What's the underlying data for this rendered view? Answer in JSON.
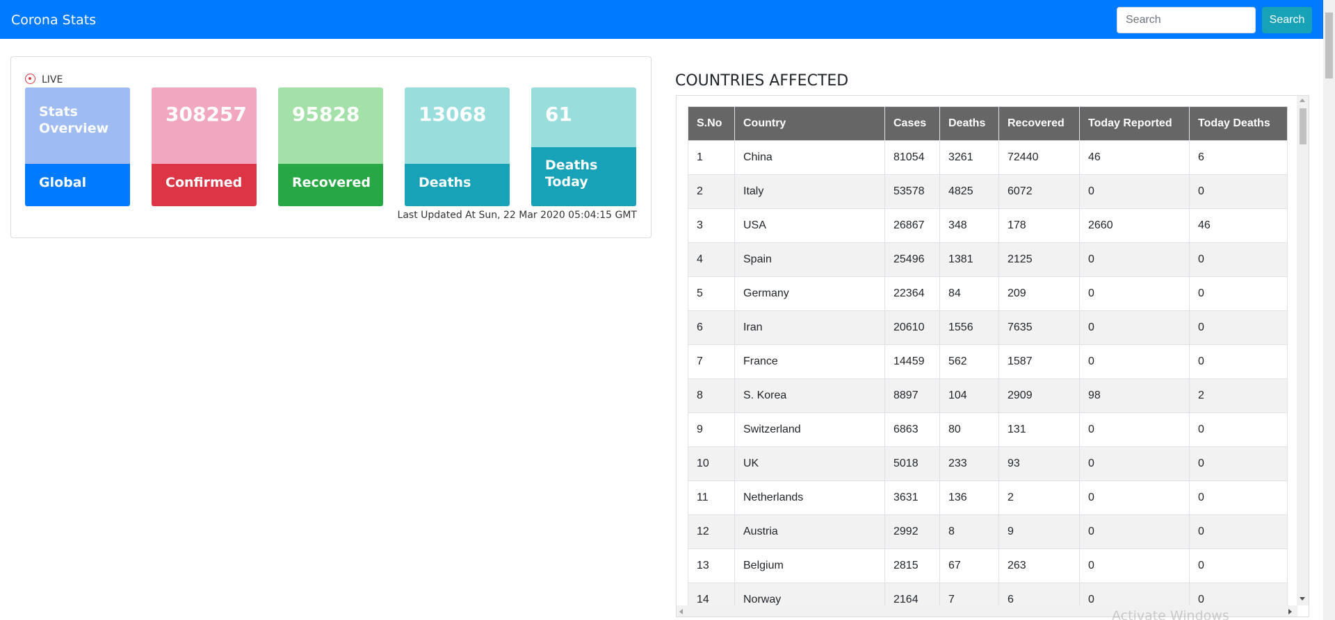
{
  "navbar": {
    "brand": "Corona Stats",
    "search_placeholder": "Search",
    "search_button": "Search"
  },
  "stats": {
    "live_label": "LIVE",
    "overview_label": "Stats Overview",
    "global_label": "Global",
    "confirmed_value": "308257",
    "confirmed_label": "Confirmed",
    "recovered_value": "95828",
    "recovered_label": "Recovered",
    "deaths_value": "13068",
    "deaths_label": "Deaths",
    "deaths_today_value": "61",
    "deaths_today_label": "Deaths Today",
    "last_updated": "Last Updated At Sun, 22 Mar 2020 05:04:15 GMT"
  },
  "countries": {
    "title": "COUNTRIES AFFECTED",
    "headers": [
      "S.No",
      "Country",
      "Cases",
      "Deaths",
      "Recovered",
      "Today Reported",
      "Today Deaths"
    ],
    "rows": [
      [
        "1",
        "China",
        "81054",
        "3261",
        "72440",
        "46",
        "6"
      ],
      [
        "2",
        "Italy",
        "53578",
        "4825",
        "6072",
        "0",
        "0"
      ],
      [
        "3",
        "USA",
        "26867",
        "348",
        "178",
        "2660",
        "46"
      ],
      [
        "4",
        "Spain",
        "25496",
        "1381",
        "2125",
        "0",
        "0"
      ],
      [
        "5",
        "Germany",
        "22364",
        "84",
        "209",
        "0",
        "0"
      ],
      [
        "6",
        "Iran",
        "20610",
        "1556",
        "7635",
        "0",
        "0"
      ],
      [
        "7",
        "France",
        "14459",
        "562",
        "1587",
        "0",
        "0"
      ],
      [
        "8",
        "S. Korea",
        "8897",
        "104",
        "2909",
        "98",
        "2"
      ],
      [
        "9",
        "Switzerland",
        "6863",
        "80",
        "131",
        "0",
        "0"
      ],
      [
        "10",
        "UK",
        "5018",
        "233",
        "93",
        "0",
        "0"
      ],
      [
        "11",
        "Netherlands",
        "3631",
        "136",
        "2",
        "0",
        "0"
      ],
      [
        "12",
        "Austria",
        "2992",
        "8",
        "9",
        "0",
        "0"
      ],
      [
        "13",
        "Belgium",
        "2815",
        "67",
        "263",
        "0",
        "0"
      ],
      [
        "14",
        "Norway",
        "2164",
        "7",
        "6",
        "0",
        "0"
      ]
    ]
  },
  "watermark": "Activate Windows",
  "colors": {
    "navbar": "#007bff",
    "primary": "#007bff",
    "danger": "#dc3545",
    "success": "#28a745",
    "info": "#17a2b8",
    "table_header": "#666666"
  }
}
